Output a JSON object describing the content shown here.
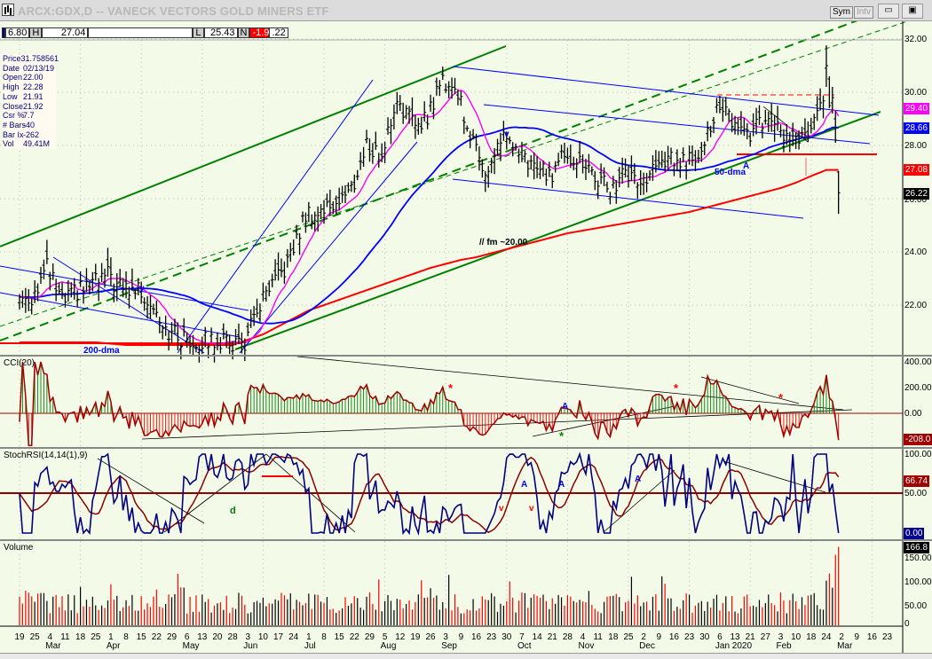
{
  "window": {
    "title": "ARCX:GDX,D -- VANECK VECTORS GOLD MINERS ETF",
    "sym_label": "Sym",
    "intv_label": "Intv",
    "minimize": "▭",
    "restore": "▣"
  },
  "toolbar": {
    "open_fragment": "6.80",
    "h_label": "H",
    "high": "27.04",
    "blank": "",
    "l_label": "L",
    "low": "25.43",
    "n_label": "N",
    "net": "-1.93",
    "close_fragment": ".22"
  },
  "info": [
    {
      "k": "Price",
      "v": "31.758561"
    },
    {
      "k": "Date",
      "v": "02/13/19"
    },
    {
      "k": "Open",
      "v": "22.00"
    },
    {
      "k": "High",
      "v": "22.28"
    },
    {
      "k": "Low",
      "v": "21.91"
    },
    {
      "k": "Close",
      "v": "21.92"
    },
    {
      "k": "Csr %",
      "v": "7.7"
    },
    {
      "k": "# Bars",
      "v": "-40"
    },
    {
      "k": "Bar Ix",
      "v": "-262"
    },
    {
      "k": "Vol",
      "v": "49.41M"
    }
  ],
  "colors": {
    "bg": "#f3fbe8",
    "ma10": "#ff00ff",
    "ma50": "#0000ff",
    "ma200": "#ff0000",
    "green": "#008000",
    "up_hist": "#008000",
    "down_hist": "#ff0000",
    "stoch": "#000080",
    "signal": "#8b0000"
  },
  "chart_data": {
    "type": "ohlc",
    "title": "ARCX:GDX,D -- VANECK VECTORS GOLD MINERS ETF",
    "ylim": [
      20.13,
      32.0
    ],
    "price_ticks": [
      "32.00",
      "30.00",
      "28.00",
      "26.00",
      "24.00",
      "22.00"
    ],
    "last_labels": {
      "ma10": "29.40",
      "ma50": "28.66",
      "ma200": "27.08",
      "close": "26.22"
    },
    "weekly_close": [
      22.3,
      23.4,
      22.1,
      22.5,
      22.8,
      23.1,
      22.5,
      22.6,
      22.0,
      21.0,
      20.7,
      20.6,
      20.7,
      20.6,
      20.6,
      22.0,
      22.8,
      23.8,
      25.4,
      25.5,
      25.9,
      26.3,
      28.0,
      27.6,
      29.8,
      28.8,
      29.1,
      30.5,
      30.0,
      28.0,
      27.0,
      28.5,
      27.4,
      27.3,
      26.8,
      27.8,
      27.4,
      26.8,
      26.3,
      27.0,
      26.6,
      27.1,
      27.5,
      27.3,
      28.0,
      29.3,
      29.0,
      28.4,
      28.8,
      28.6,
      28.1,
      28.3,
      29.9
    ],
    "final_week_daily": [
      {
        "o": 30.9,
        "h": 31.76,
        "l": 30.2,
        "c": 31.0
      },
      {
        "o": 30.5,
        "h": 30.6,
        "l": 29.4,
        "c": 29.5
      },
      {
        "o": 29.6,
        "h": 30.2,
        "l": 29.2,
        "c": 29.8
      },
      {
        "o": 29.0,
        "h": 29.3,
        "l": 28.1,
        "c": 28.2
      },
      {
        "o": 27.0,
        "h": 27.04,
        "l": 25.43,
        "c": 26.22
      }
    ],
    "ma200_weekly": [
      20.6,
      20.6,
      20.6,
      20.6,
      20.6,
      20.6,
      20.55,
      20.5,
      20.5,
      20.5,
      20.5,
      20.5,
      20.5,
      20.5,
      20.5,
      20.7,
      20.9,
      21.2,
      21.5,
      21.8,
      22.0,
      22.2,
      22.4,
      22.6,
      22.8,
      23.0,
      23.2,
      23.4,
      23.55,
      23.7,
      23.8,
      23.95,
      24.1,
      24.25,
      24.4,
      24.55,
      24.7,
      24.8,
      24.9,
      25.0,
      25.1,
      25.2,
      25.3,
      25.4,
      25.5,
      25.65,
      25.8,
      25.95,
      26.1,
      26.25,
      26.4,
      26.6,
      26.85,
      27.08
    ],
    "cci": {
      "label": "CCI(20)",
      "ticks": [
        "400.00",
        "200.00",
        "0.00"
      ],
      "last": "-208.0"
    },
    "stochrsi": {
      "label": "StochRSI(14,14(1),9)",
      "ticks": [
        "100.00",
        "50.00"
      ],
      "last_signal": "66.74",
      "last": "0.00"
    },
    "volume": {
      "label": "Volume",
      "ticks": [
        "150.00",
        "100.00",
        "50.00",
        "0"
      ],
      "last": "166.8"
    },
    "x_day_labels": [
      "19",
      "25",
      "4",
      "11",
      "18",
      "25",
      "1",
      "8",
      "15",
      "22",
      "29",
      "6",
      "13",
      "20",
      "28",
      "3",
      "10",
      "17",
      "24",
      "1",
      "8",
      "15",
      "22",
      "29",
      "5",
      "12",
      "19",
      "26",
      "3",
      "9",
      "16",
      "23",
      "30",
      "7",
      "14",
      "21",
      "28",
      "4",
      "11",
      "18",
      "25",
      "2",
      "9",
      "16",
      "23",
      "30",
      "6",
      "13",
      "21",
      "27",
      "3",
      "10",
      "18",
      "24",
      "2",
      "9",
      "16",
      "23"
    ],
    "x_month_labels": [
      {
        "label": "Mar",
        "week": 2
      },
      {
        "label": "Apr",
        "week": 6
      },
      {
        "label": "May",
        "week": 11
      },
      {
        "label": "Jun",
        "week": 15
      },
      {
        "label": "Jul",
        "week": 19
      },
      {
        "label": "Aug",
        "week": 24
      },
      {
        "label": "Sep",
        "week": 28
      },
      {
        "label": "Oct",
        "week": 33
      },
      {
        "label": "Nov",
        "week": 37
      },
      {
        "label": "Dec",
        "week": 41
      },
      {
        "label": "Jan 2020",
        "week": 46
      },
      {
        "label": "Feb",
        "week": 50
      },
      {
        "label": "Mar",
        "week": 54
      }
    ]
  },
  "annotations": {
    "ma200": "200-dma",
    "ma50": "50-dma",
    "fm": "// fm ~20.00",
    "v": "v",
    "a": "A",
    "star": "*",
    "d": "d"
  }
}
